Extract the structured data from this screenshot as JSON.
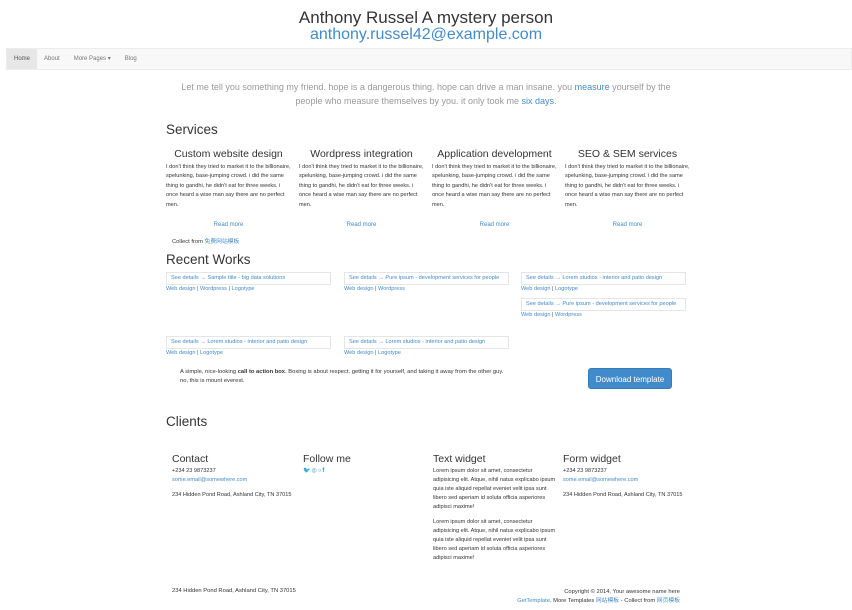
{
  "header": {
    "title": "Anthony Russel A mystery person",
    "email": "anthony.russel42@example.com"
  },
  "nav": {
    "items": [
      "Home",
      "About",
      "More Pages ▾",
      "Blog"
    ]
  },
  "lead": {
    "part1": "Let me tell you something my friend. hope is a dangerous thing. hope can drive a man insane. you ",
    "link1": "measure",
    "part2": " yourself by the people who measure themselves by you. it only took me ",
    "link2": "six days",
    "part3": "."
  },
  "services": {
    "heading": "Services",
    "items": [
      {
        "title": "Custom website design",
        "text": "I don't think they tried to market it to the billionaire, spelunking, base-jumping crowd. i did the same thing to gandhi, he didn't eat for three weeks. i once heard a wise man say there are no perfect men.",
        "link": "Read more"
      },
      {
        "title": "Wordpress integration",
        "text": "I don't think they tried to market it to the billionaire, spelunking, base-jumping crowd. i did the same thing to gandhi, he didn't eat for three weeks. i once heard a wise man say there are no perfect men.",
        "link": "Read more"
      },
      {
        "title": "Application development",
        "text": "I don't think they tried to market it to the billionaire, spelunking, base-jumping crowd. i did the same thing to gandhi, he didn't eat for three weeks. i once heard a wise man say there are no perfect men.",
        "link": "Read more"
      },
      {
        "title": "SEO & SEM services",
        "text": "I don't think they tried to market it to the billionaire, spelunking, base-jumping crowd. i did the same thing to gandhi, he didn't eat for three weeks. i once heard a wise man say there are no perfect men.",
        "link": "Read more"
      }
    ],
    "collect_label": "Collect from ",
    "collect_link": "免费网站模板"
  },
  "works": {
    "heading": "Recent Works",
    "items": [
      {
        "title": "See details → Sample title - big data solutions",
        "tags": [
          "Web design",
          "Wordpress",
          "Logotype"
        ]
      },
      {
        "title": "See details → Pure ipsum - development services for people",
        "tags": [
          "Web design",
          "Wordpress"
        ]
      },
      {
        "title": "See details → Lorem studios - interior and patio design",
        "tags": [
          "Web design",
          "Logotype"
        ]
      },
      {
        "title": "See details → Pure ipsum - development services for people",
        "tags": [
          "Web design",
          "Wordpress"
        ]
      },
      {
        "title": "See details → Lorem studios - interior and patio design",
        "tags": [
          "Web design",
          "Logotype"
        ]
      },
      {
        "title": "See details → Lorem studios - interior and patio design",
        "tags": [
          "Web design",
          "Logotype"
        ]
      }
    ]
  },
  "cta": {
    "pre": "A simple, nice-looking ",
    "bold": "call to action box",
    "post": ". Boxing is about respect. getting it for yourself, and taking it away from the other guy. no, this is mount everest.",
    "button": "Download template"
  },
  "clients": {
    "heading": "Clients"
  },
  "footer": {
    "contact": {
      "title": "Contact",
      "phone": "+234 23 9873237",
      "email": "some.email@somewhere.com",
      "address": "234 Hidden Pond Road, Ashland City, TN 37015"
    },
    "follow": {
      "title": "Follow me",
      "icons": [
        "twitter-icon",
        "dribbble-icon",
        "github-icon",
        "facebook-icon"
      ]
    },
    "text_widget": {
      "title": "Text widget",
      "p1": "Lorem ipsum dolor sit amet, consectetur adipisicing elit. Atque, nihil natus explicabo ipsum quia iste aliquid repellat eveniet velit ipsa sunt libero sed aperiam id soluta officia asperiores adipisci maxime!",
      "p2": "Lorem ipsum dolor sit amet, consectetur adipisicing elit. Atque, nihil natus explicabo ipsum quia iste aliquid repellat eveniet velit ipsa sunt libero sed aperiam id soluta officia asperiores adipisci maxime!"
    },
    "form_widget": {
      "title": "Form widget",
      "phone": "+234 23 9873237",
      "email": "some.email@somewhere.com",
      "address": "234 Hidden Pond Road, Ashland City, TN 37015"
    },
    "bottom_address": "234 Hidden Pond Road, Ashland City, TN 37015",
    "copyright": "Copyright © 2014, Your awesome name here",
    "gettemplate": "GetTemplate",
    "more_label": ". More Templates ",
    "more_link": "网站模板",
    "collect_label": " - Collect from ",
    "collect_link": "网页模板"
  }
}
